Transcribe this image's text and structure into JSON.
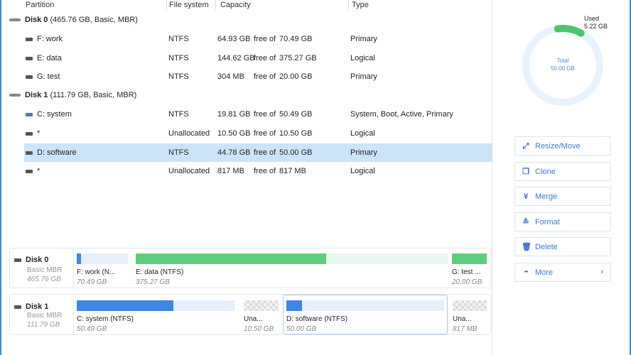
{
  "header": {
    "partition": "Partition",
    "filesystem": "File system",
    "capacity": "Capacity",
    "type": "Type"
  },
  "disks": [
    {
      "name": "Disk 0",
      "info": "(465.76 GB, Basic, MBR)",
      "partitions": [
        {
          "name": "F: work",
          "fs": "NTFS",
          "free": "64.93 GB",
          "freeof": "free of",
          "total": "70.49 GB",
          "type": "Primary"
        },
        {
          "name": "E: data",
          "fs": "NTFS",
          "free": "144.62 GB",
          "freeof": "free of",
          "total": "375.27 GB",
          "type": "Logical"
        },
        {
          "name": "G: test",
          "fs": "NTFS",
          "free": "304 MB",
          "freeof": "free of",
          "total": "20.00 GB",
          "type": "Primary"
        }
      ]
    },
    {
      "name": "Disk 1",
      "info": "(111.79 GB, Basic, MBR)",
      "partitions": [
        {
          "name": "C: system",
          "fs": "NTFS",
          "free": "19.81 GB",
          "freeof": "free of",
          "total": "50.49 GB",
          "type": "System, Boot, Active, Primary"
        },
        {
          "name": "*",
          "fs": "Unallocated",
          "free": "10.50 GB",
          "freeof": "free of",
          "total": "10.50 GB",
          "type": "Logical"
        },
        {
          "name": "D: software",
          "fs": "NTFS",
          "free": "44.78 GB",
          "freeof": "free of",
          "total": "50.00 GB",
          "type": "Primary"
        },
        {
          "name": "*",
          "fs": "Unallocated",
          "free": "817 MB",
          "freeof": "free of",
          "total": "817 MB",
          "type": "Logical"
        }
      ]
    }
  ],
  "map": {
    "disk0": {
      "name": "Disk 0",
      "type": "Basic MBR",
      "size": "465.76 GB",
      "segs": [
        {
          "label": "F: work (N...",
          "size": "70.49 GB",
          "used": 0.08
        },
        {
          "label": "E: data (NTFS)",
          "size": "375.27 GB",
          "used": 0.61
        },
        {
          "label": "G: test ...",
          "size": "20.00 GB",
          "used": 0.99
        }
      ]
    },
    "disk1": {
      "name": "Disk 1",
      "type": "Basic MBR",
      "size": "111.79 GB",
      "segs": [
        {
          "label": "C: system (NTFS)",
          "size": "50.49 GB",
          "used": 0.61
        },
        {
          "label": "Una...",
          "size": "10.50 GB"
        },
        {
          "label": "D: software (NTFS)",
          "size": "50.00 GB",
          "used": 0.1
        },
        {
          "label": "Una...",
          "size": "817 MB"
        }
      ]
    }
  },
  "donut": {
    "used_label": "Used",
    "used": "5.22 GB",
    "total_label": "Total",
    "total": "50.00 GB",
    "used_fraction": 0.1044,
    "color_used": "#4cc46e",
    "color_track": "#e8f2fc"
  },
  "actions": [
    {
      "label": "Resize/Move",
      "icon": "resize-icon"
    },
    {
      "label": "Clone",
      "icon": "clone-icon"
    },
    {
      "label": "Merge",
      "icon": "merge-icon"
    },
    {
      "label": "Format",
      "icon": "format-icon"
    },
    {
      "label": "Delete",
      "icon": "trash-icon"
    },
    {
      "label": "More",
      "icon": "more-icon"
    }
  ]
}
